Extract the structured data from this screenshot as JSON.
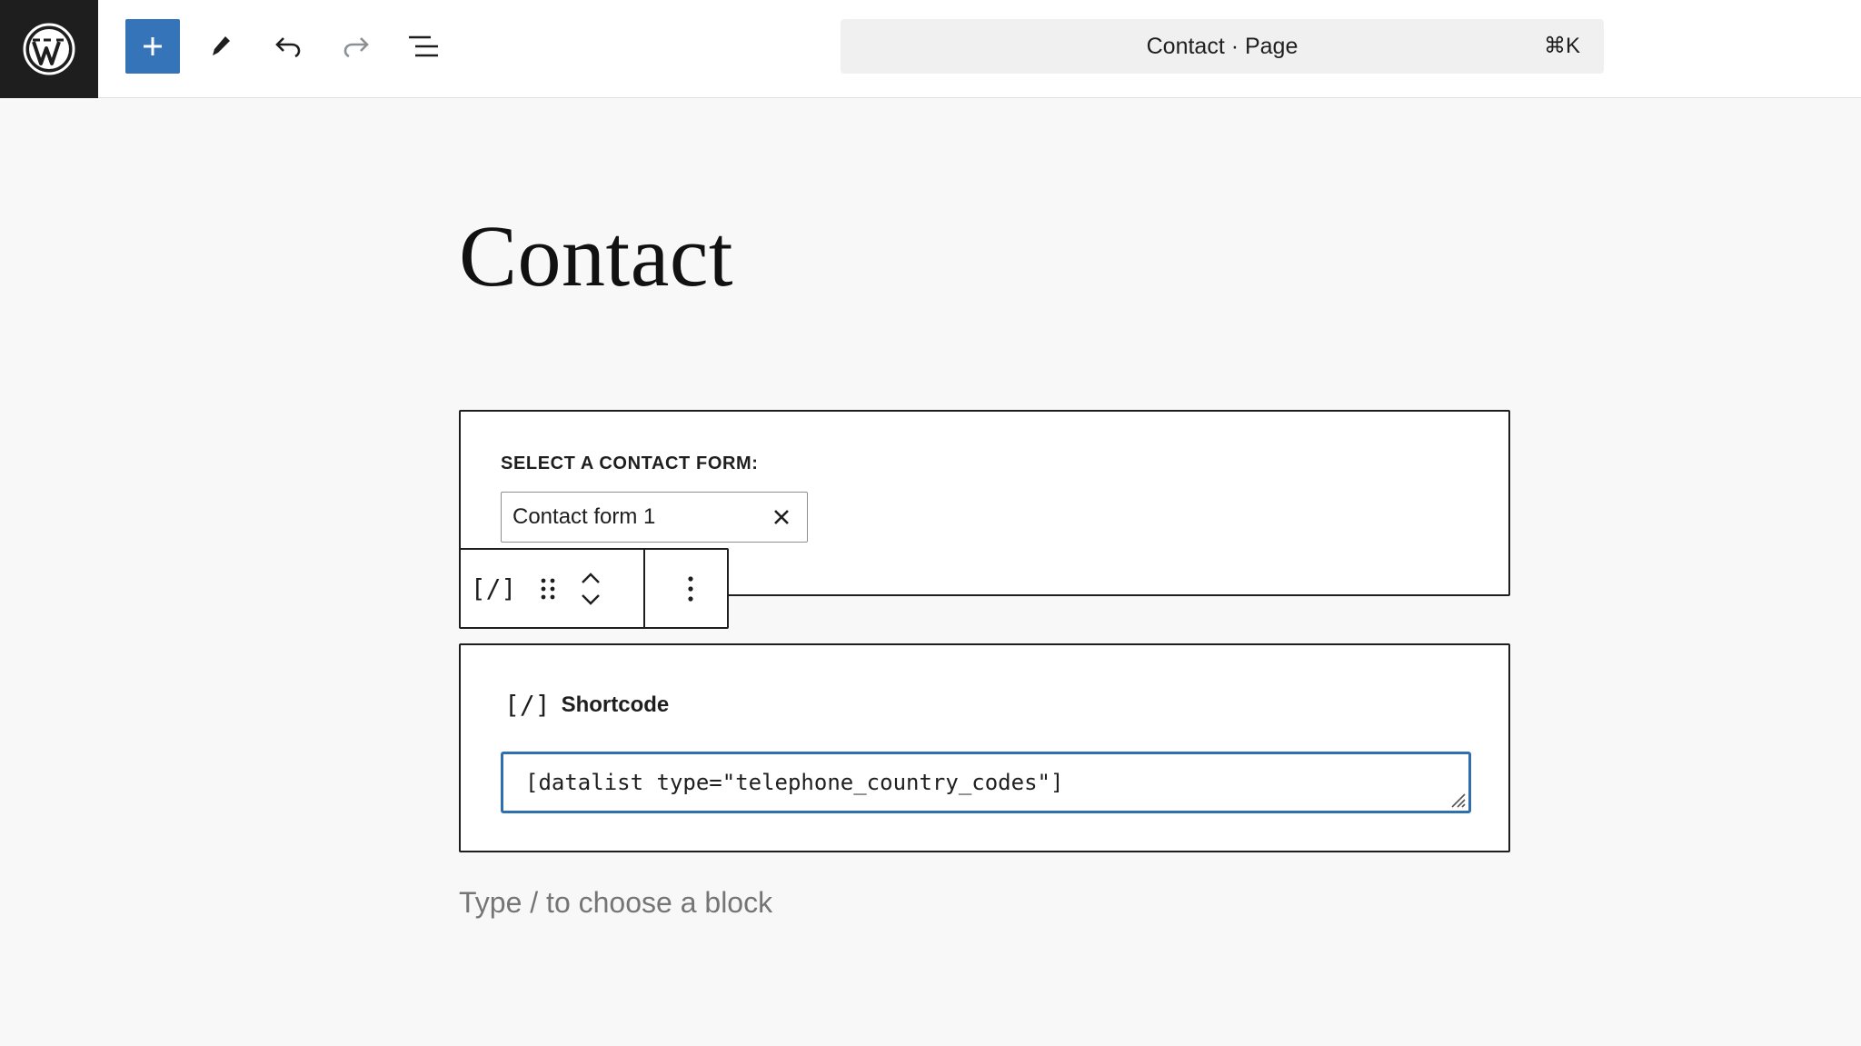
{
  "header": {
    "logo_icon": "wordpress-logo-icon",
    "add_icon": "plus-icon",
    "edit_icon": "pencil-icon",
    "undo_icon": "undo-icon",
    "redo_icon": "redo-icon",
    "list_view_icon": "list-view-icon",
    "command_bar": {
      "title": "Contact · Page",
      "shortcut": "⌘K"
    },
    "accent_color": "#3574b8"
  },
  "page": {
    "title": "Contact"
  },
  "contact_form_block": {
    "label": "SELECT A CONTACT FORM:",
    "selected_form": "Contact form 1",
    "clear_icon": "close-icon"
  },
  "block_toolbar": {
    "block_type_icon": "[/]",
    "drag_icon": "drag-handle-icon",
    "move_up_icon": "chevron-up-icon",
    "move_down_icon": "chevron-down-icon",
    "options_icon": "more-vertical-icon"
  },
  "shortcode_block": {
    "icon": "[/]",
    "label": "Shortcode",
    "value": "[datalist type=\"telephone_country_codes\"]",
    "focus_color": "#2f6fb0"
  },
  "appender": {
    "placeholder": "Type / to choose a block"
  }
}
